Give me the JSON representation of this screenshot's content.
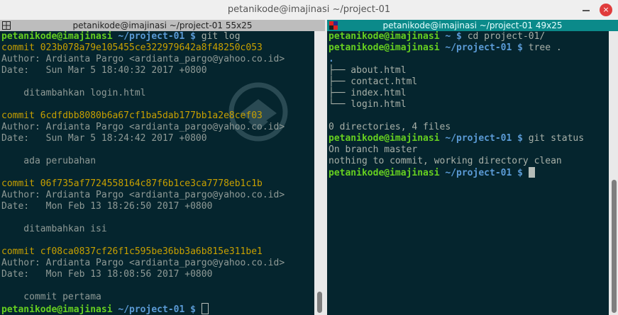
{
  "window": {
    "title": "petanikode@imajinasi ~/project-01",
    "close_label": "×"
  },
  "panes": {
    "left": {
      "title": "petanikode@imajinasi ~/project-01 55x25",
      "lines": [
        {
          "segments": [
            {
              "t": "petanikode@imajinasi",
              "c": "green"
            },
            {
              "t": " ~/project-01 $ ",
              "c": "blue"
            },
            {
              "t": "git log",
              "c": ""
            }
          ]
        },
        {
          "segments": [
            {
              "t": "commit 023b078a79e105455ce322979642a8f48250c053",
              "c": "yellow"
            }
          ]
        },
        {
          "segments": [
            {
              "t": "Author: Ardianta Pargo <ardianta_pargo@yahoo.co.id>",
              "c": "dim"
            }
          ]
        },
        {
          "segments": [
            {
              "t": "Date:   Sun Mar 5 18:40:32 2017 +0800",
              "c": "dim"
            }
          ]
        },
        {
          "segments": []
        },
        {
          "segments": [
            {
              "t": "    ditambahkan login.html",
              "c": "dim"
            }
          ]
        },
        {
          "segments": []
        },
        {
          "segments": [
            {
              "t": "commit 6cdfdbb8080b6a67cf1ba5dab177bb1a2e8cef03",
              "c": "yellow"
            }
          ]
        },
        {
          "segments": [
            {
              "t": "Author: Ardianta Pargo <ardianta_pargo@yahoo.co.id>",
              "c": "dim"
            }
          ]
        },
        {
          "segments": [
            {
              "t": "Date:   Sun Mar 5 18:24:42 2017 +0800",
              "c": "dim"
            }
          ]
        },
        {
          "segments": []
        },
        {
          "segments": [
            {
              "t": "    ada perubahan",
              "c": "dim"
            }
          ]
        },
        {
          "segments": []
        },
        {
          "segments": [
            {
              "t": "commit 06f735af7724558164c87f6b1ce3ca7778eb1c1b",
              "c": "yellow"
            }
          ]
        },
        {
          "segments": [
            {
              "t": "Author: Ardianta Pargo <ardianta_pargo@yahoo.co.id>",
              "c": "dim"
            }
          ]
        },
        {
          "segments": [
            {
              "t": "Date:   Mon Feb 13 18:26:50 2017 +0800",
              "c": "dim"
            }
          ]
        },
        {
          "segments": []
        },
        {
          "segments": [
            {
              "t": "    ditambahkan isi",
              "c": "dim"
            }
          ]
        },
        {
          "segments": []
        },
        {
          "segments": [
            {
              "t": "commit cf08ca0837cf26f1c595be36bb3a6b815e311be1",
              "c": "yellow"
            }
          ]
        },
        {
          "segments": [
            {
              "t": "Author: Ardianta Pargo <ardianta_pargo@yahoo.co.id>",
              "c": "dim"
            }
          ]
        },
        {
          "segments": [
            {
              "t": "Date:   Mon Feb 13 18:08:56 2017 +0800",
              "c": "dim"
            }
          ]
        },
        {
          "segments": []
        },
        {
          "segments": [
            {
              "t": "    commit pertama",
              "c": "dim"
            }
          ]
        },
        {
          "segments": [
            {
              "t": "petanikode@imajinasi",
              "c": "green"
            },
            {
              "t": " ~/project-01 $ ",
              "c": "blue"
            }
          ],
          "cursor": "hollow"
        }
      ]
    },
    "right": {
      "title": "petanikode@imajinasi ~/project-01 49x25",
      "lines": [
        {
          "segments": [
            {
              "t": "petanikode@imajinasi",
              "c": "green"
            },
            {
              "t": " ~ $ ",
              "c": "blue"
            },
            {
              "t": "cd project-01/",
              "c": ""
            }
          ]
        },
        {
          "segments": [
            {
              "t": "petanikode@imajinasi",
              "c": "green"
            },
            {
              "t": " ~/project-01 $ ",
              "c": "blue"
            },
            {
              "t": "tree .",
              "c": ""
            }
          ]
        },
        {
          "segments": [
            {
              "t": ".",
              "c": "blue"
            }
          ]
        },
        {
          "segments": [
            {
              "t": "├── about.html",
              "c": ""
            }
          ]
        },
        {
          "segments": [
            {
              "t": "├── contact.html",
              "c": ""
            }
          ]
        },
        {
          "segments": [
            {
              "t": "├── index.html",
              "c": ""
            }
          ]
        },
        {
          "segments": [
            {
              "t": "└── login.html",
              "c": ""
            }
          ]
        },
        {
          "segments": []
        },
        {
          "segments": [
            {
              "t": "0 directories, 4 files",
              "c": ""
            }
          ]
        },
        {
          "segments": [
            {
              "t": "petanikode@imajinasi",
              "c": "green"
            },
            {
              "t": " ~/project-01 $ ",
              "c": "blue"
            },
            {
              "t": "git status",
              "c": ""
            }
          ]
        },
        {
          "segments": [
            {
              "t": "On branch master",
              "c": ""
            }
          ]
        },
        {
          "segments": [
            {
              "t": "nothing to commit, working directory clean",
              "c": ""
            }
          ]
        },
        {
          "segments": [
            {
              "t": "petanikode@imajinasi",
              "c": "green"
            },
            {
              "t": " ~/project-01 $ ",
              "c": "blue"
            }
          ],
          "cursor": "solid"
        }
      ]
    }
  },
  "colors": {
    "terminal_bg": "#05252e",
    "prompt_user": "#66d020",
    "prompt_path": "#5b9bd6",
    "commit_hash": "#c8a000",
    "active_pane_title": "#0b8a8a"
  },
  "icons": {
    "left_pane": "split-layout-icon",
    "right_pane": "terminator-grid-icon",
    "watermark": "petanikode-logo"
  }
}
